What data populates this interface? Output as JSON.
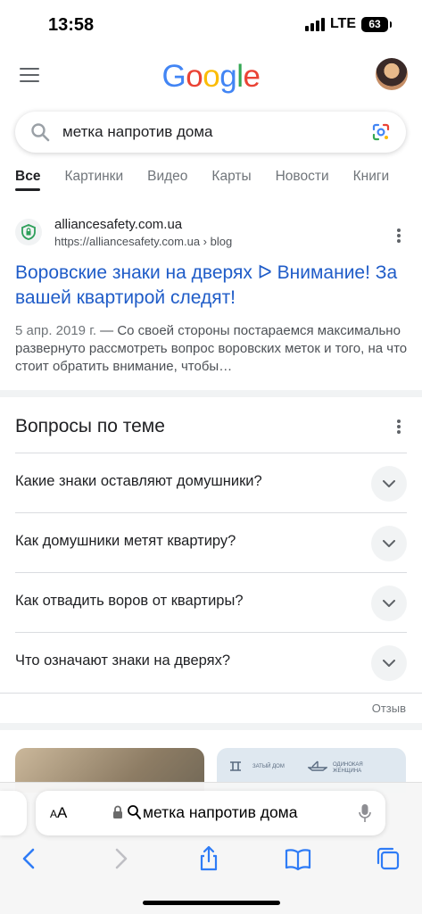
{
  "status": {
    "time": "13:58",
    "network": "LTE",
    "battery": "63"
  },
  "header": {
    "logo_letters": [
      "G",
      "o",
      "o",
      "g",
      "l",
      "e"
    ],
    "logo_colors": [
      "#4285F4",
      "#EA4335",
      "#FBBC05",
      "#4285F4",
      "#34A853",
      "#EA4335"
    ]
  },
  "search": {
    "query": "метка напротив дома"
  },
  "tabs": [
    "Все",
    "Картинки",
    "Видео",
    "Карты",
    "Новости",
    "Книги"
  ],
  "result": {
    "site_name": "alliancesafety.com.ua",
    "url": "https://alliancesafety.com.ua › blog",
    "title": "Воровские знаки на дверях ᐅ Внимание! За вашей квартирой следят!",
    "date": "5 апр. 2019 г.",
    "snippet": " — Со своей стороны постараемся максимально развернуто рассмотреть вопрос воровских меток и того, на что стоит обратить внимание, чтобы…"
  },
  "paa": {
    "title": "Вопросы по теме",
    "questions": [
      "Какие знаки оставляют домушники?",
      "Как домушники метят квартиру?",
      "Как отвадить воров от квартиры?",
      "Что означают знаки на дверях?"
    ],
    "feedback": "Отзыв"
  },
  "images": {
    "img2_text1": "ЗАТЫЙ ДОМ",
    "img2_text2": "ОДИНОКАЯ ЖЕНЩИНА"
  },
  "safari": {
    "aa_label": "AA",
    "url_text": "метка напротив дома"
  }
}
